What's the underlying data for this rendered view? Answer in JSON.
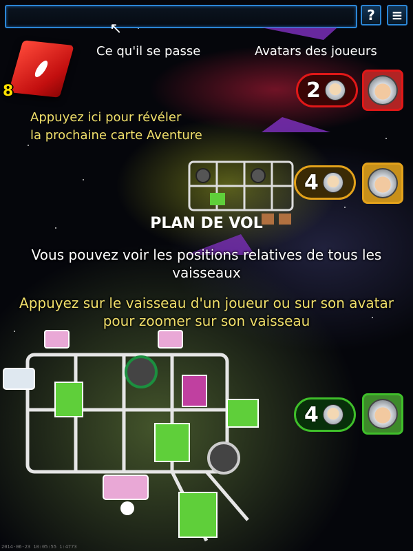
{
  "ui": {
    "help_label": "?",
    "menu_label": "≡",
    "deck_count": "8"
  },
  "hints": {
    "event_bar": "Ce qu'il se passe",
    "avatars": "Avatars des joueurs",
    "card_line1": "Appuyez ici pour révéler",
    "card_line2": "la prochaine carte Aventure"
  },
  "flight_plan": {
    "title": "PLAN DE VOL",
    "description": "Vous pouvez voir les positions relatives de tous les vaisseaux",
    "instruction": "Appuyez sur le vaisseau d'un joueur ou sur son avatar pour zoomer sur son vaisseau"
  },
  "players": [
    {
      "position": "2",
      "color": "#e01818",
      "bg": "#5a0707"
    },
    {
      "position": "4",
      "color": "#e3a21b",
      "bg": "#6a4a07"
    },
    {
      "position": "4",
      "color": "#3fbf2a",
      "bg": "#0f4d0f"
    }
  ],
  "timestamp": "2014-06-23 10:05:55 1:4773"
}
